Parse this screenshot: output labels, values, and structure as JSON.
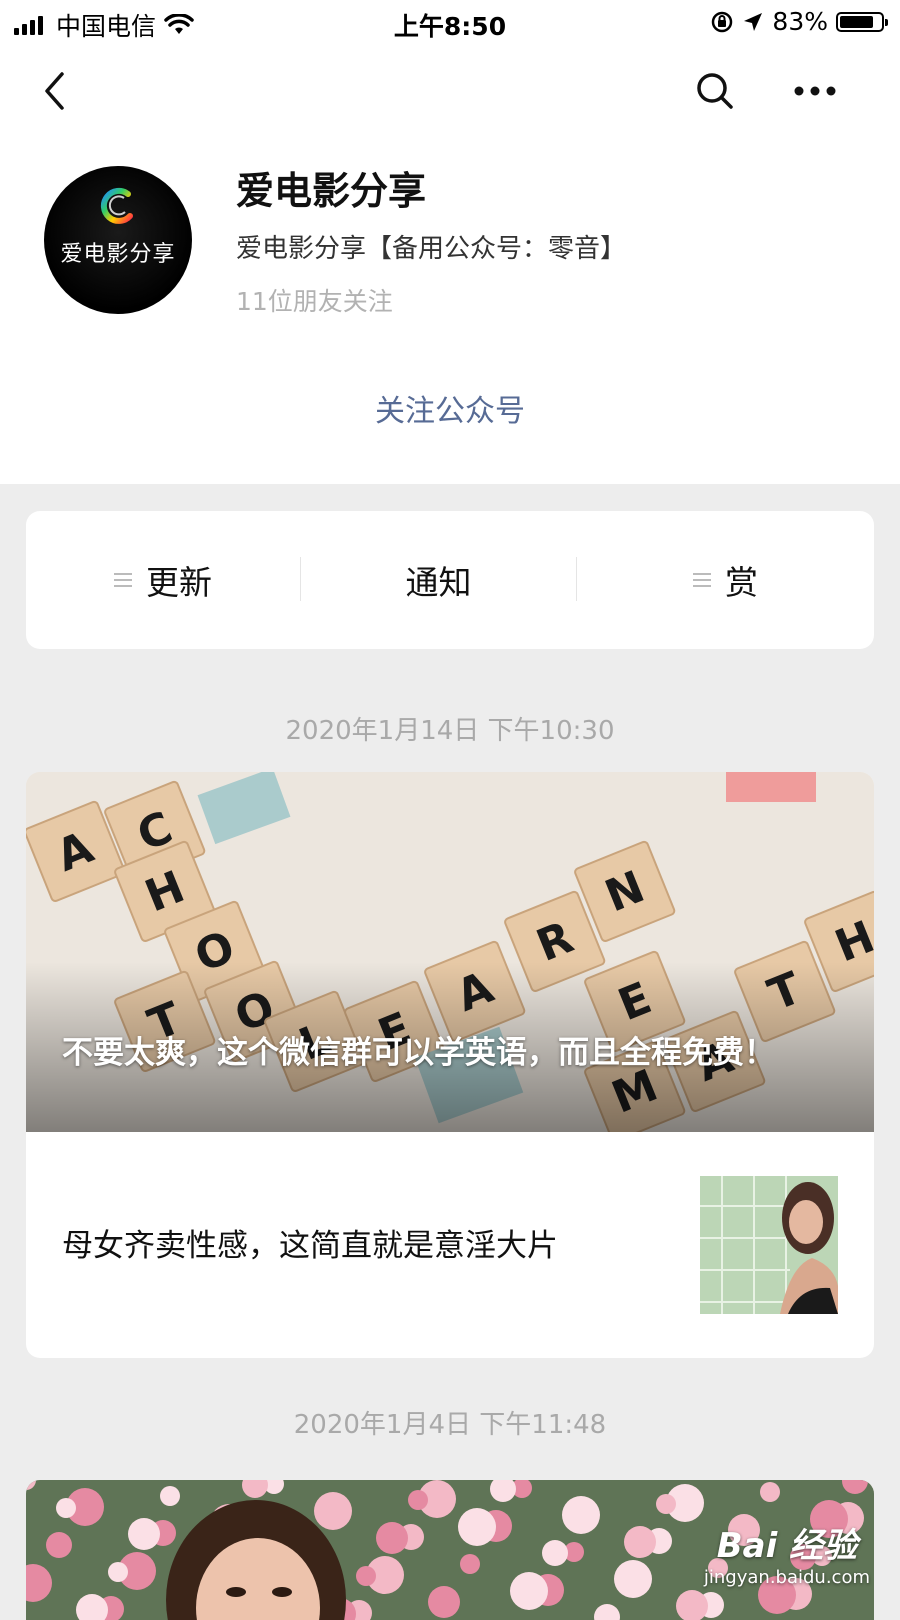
{
  "status_bar": {
    "carrier": "中国电信",
    "time": "上午8:50",
    "battery_percent": "83%",
    "battery_level": 0.83
  },
  "nav": {
    "back_icon": "chevron-left-icon",
    "search_icon": "search-icon",
    "more_icon": "more-horizontal-icon"
  },
  "account": {
    "avatar_text": "爱电影分享",
    "name": "爱电影分享",
    "description": "爱电影分享【备用公众号：零音】",
    "followers": "11位朋友关注",
    "follow_label": "关注公众号"
  },
  "menu": {
    "items": [
      {
        "label": "更新",
        "has_submenu": true
      },
      {
        "label": "通知",
        "has_submenu": false
      },
      {
        "label": "赏",
        "has_submenu": true
      }
    ]
  },
  "feed": [
    {
      "date": "2020年1月14日 下午10:30",
      "cover_title": "不要太爽，这个微信群可以学英语，而且全程免费！",
      "cover_tiles": [
        "A",
        "C",
        "H",
        "O",
        "T",
        "O",
        "L",
        "E",
        "A",
        "R",
        "N",
        "E",
        "M",
        "A",
        "T",
        "H"
      ],
      "sub_articles": [
        {
          "title": "母女齐卖性感，这简直就是意淫大片"
        }
      ]
    },
    {
      "date": "2020年1月4日 下午11:48"
    }
  ],
  "watermark": {
    "logo": "Bai 经验",
    "url": "jingyan.baidu.com"
  },
  "colors": {
    "link": "#576b95",
    "muted": "#b2b2b2",
    "background": "#ededed"
  }
}
